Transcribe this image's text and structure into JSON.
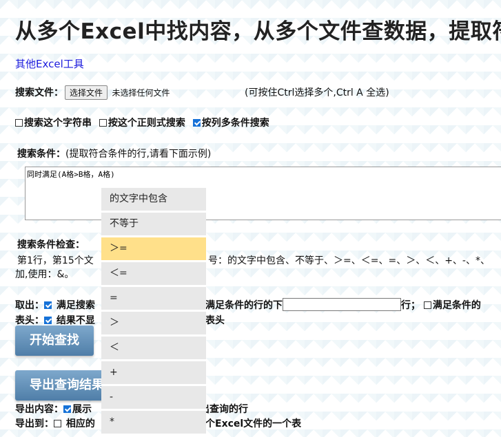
{
  "title": "从多个Excel中找内容，从多个文件查数据，提取符",
  "other_tools_link": "其他Excel工具",
  "search_files": {
    "label": "搜索文件：",
    "choose_button": "选择文件",
    "no_file": "未选择任何文件",
    "hint": "(可按住Ctrl选择多个,Ctrl A 全选)"
  },
  "modes": {
    "string": "搜索这个字符串",
    "regex": "按这个正则式搜索",
    "multi_column": "按列多条件搜索"
  },
  "criteria": {
    "label": "搜索条件：",
    "hint": "(提取符合条件的行,请看下面示例)",
    "value": "同时满足(A格>B格，A格)"
  },
  "check": {
    "label": "搜索条件检查：",
    "line1": "第1行，第15个文",
    "line1_tail": "号：的文字中包含、不等于、＞=、＜=、=、＞、＜、+、-、*、",
    "line2": "加,使用：&。"
  },
  "extract": {
    "label": "取出：",
    "opt1": "满足搜索",
    "opt2_mid": "满足条件的行的下",
    "row_suffix": "行；",
    "opt3": "满足条件的"
  },
  "header_row": {
    "label": "表头：",
    "opt1": "结果不显",
    "opt_tail": "表头"
  },
  "buttons": {
    "start": "开始查找",
    "export": "导出查询结果"
  },
  "export_content": {
    "label": "导出内容：",
    "opt": "展示",
    "tail": "出查询的行"
  },
  "export_to": {
    "label": "导出到：",
    "opt": "相应的",
    "tail": "个Excel文件的一个表"
  },
  "dropdown": {
    "selected_index": 2,
    "items": [
      "的文字中包含",
      "不等于",
      "＞=",
      "＜=",
      "=",
      "＞",
      "＜",
      "+",
      "-",
      "*"
    ]
  }
}
